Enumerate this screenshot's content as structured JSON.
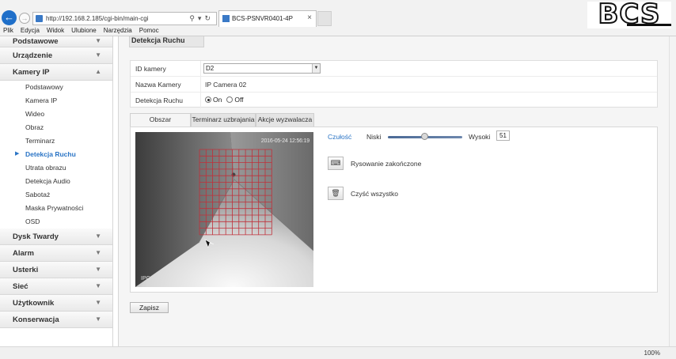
{
  "browser": {
    "address": "http://192.168.2.185/cgi-bin/main-cgi",
    "tab_title": "BCS-PSNVR0401-4P",
    "zoom": "100%",
    "menu": [
      "Plik",
      "Edycja",
      "Widok",
      "Ulubione",
      "Narzędzia",
      "Pomoc"
    ]
  },
  "brand": {
    "logo": "BCS"
  },
  "sidebar": {
    "sections_top": [
      "Podstawowe",
      "Urządzenie"
    ],
    "active_section": "Kamery IP",
    "sub_items": [
      "Podstawowy",
      "Kamera IP",
      "Wideo",
      "Obraz",
      "Terminarz",
      "Detekcja Ruchu",
      "Utrata obrazu",
      "Detekcja Audio",
      "Sabotaż",
      "Maska Prywatności",
      "OSD"
    ],
    "active_sub": "Detekcja Ruchu",
    "sections_bottom": [
      "Dysk Twardy",
      "Alarm",
      "Usterki",
      "Sieć",
      "Użytkownik",
      "Konserwacja"
    ]
  },
  "page": {
    "title": "Detekcja Ruchu",
    "camera_id_label": "ID kamery",
    "camera_id_value": "D2",
    "camera_name_label": "Nazwa Kamery",
    "camera_name_value": "IP Camera 02",
    "motion_label": "Detekcja Ruchu",
    "motion_on": "On",
    "motion_off": "Off",
    "motion_selected": "On",
    "tabs": [
      "Obszar",
      "Terminarz uzbrajania",
      "Akcje wyzwalacza"
    ],
    "active_tab": "Obszar",
    "camera_timestamp": "2016-05-24 12:56:19",
    "camera_label": "IPC",
    "sensitivity_label": "Czułość",
    "low_label": "Niski",
    "high_label": "Wysoki",
    "sensitivity_value": "51",
    "draw_done_label": "Rysowanie zakończone",
    "clear_all_label": "Czyść wszystko",
    "save_label": "Zapisz"
  },
  "colors": {
    "accent": "#2a74c5",
    "grid_line": "#c0303a",
    "ie_blue": "#1f6fc9"
  }
}
